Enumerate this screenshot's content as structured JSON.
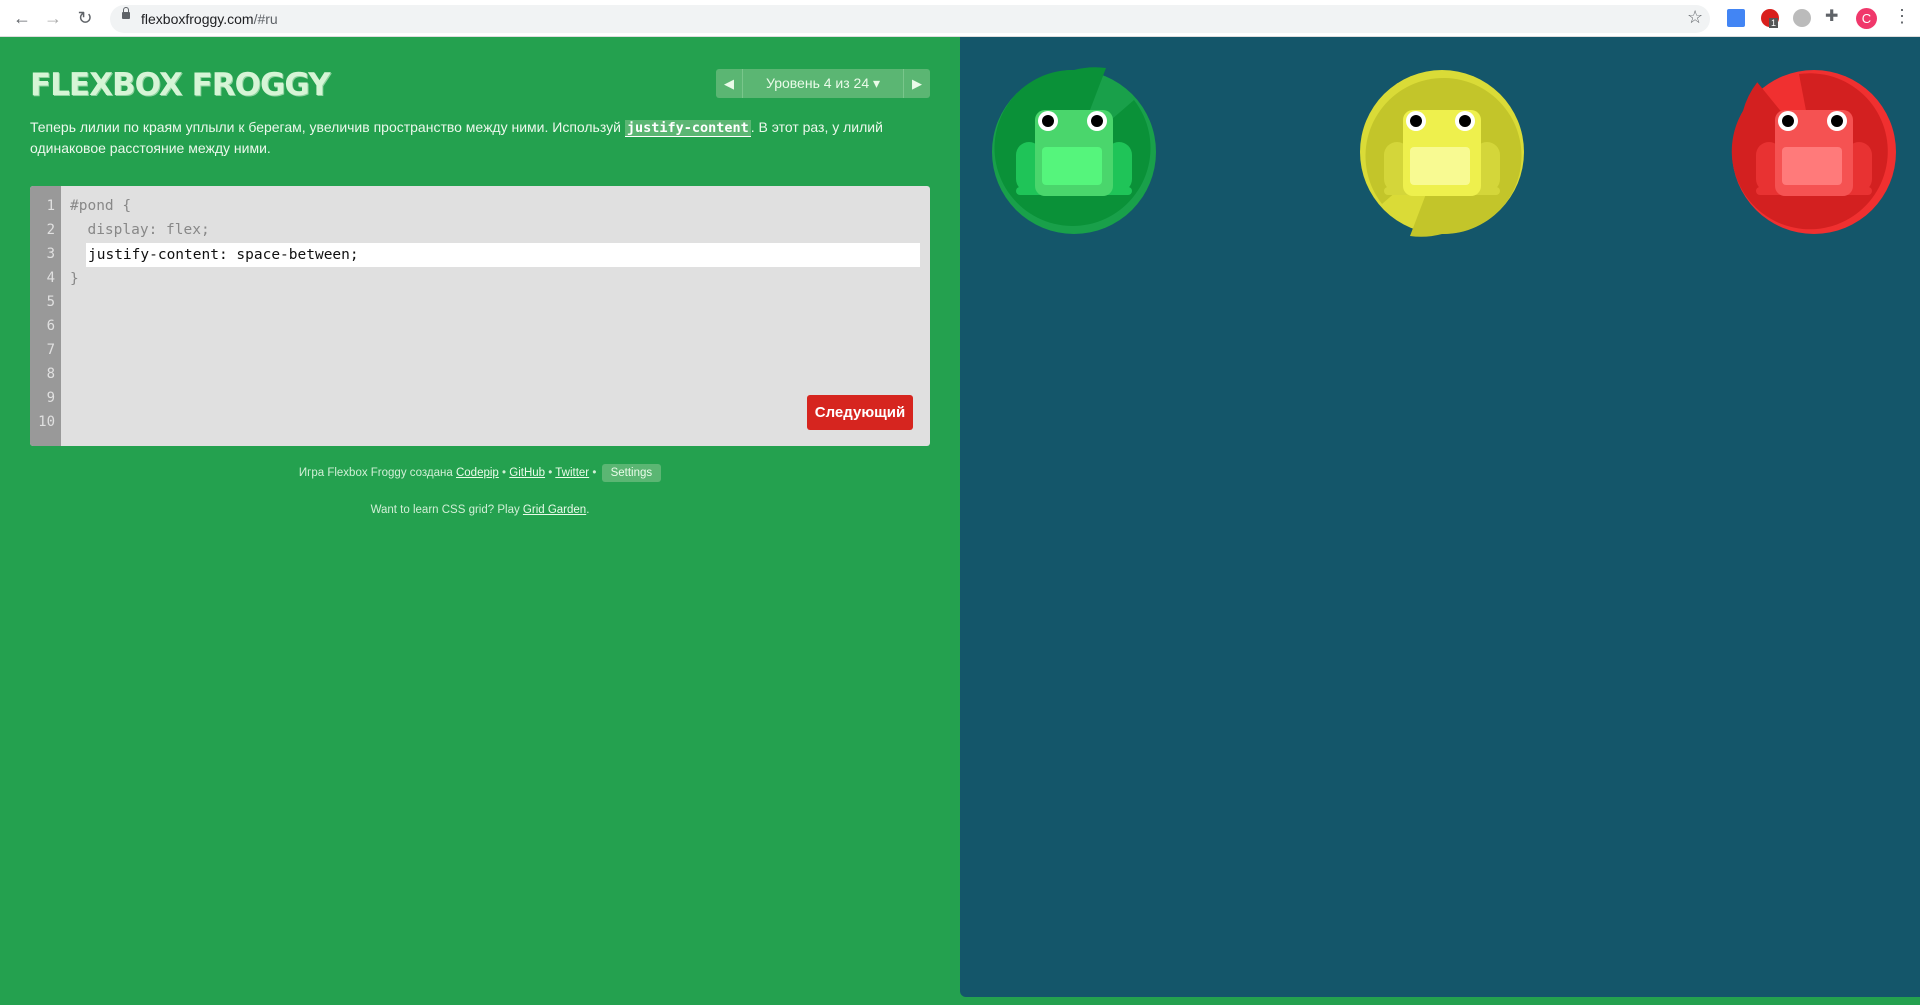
{
  "browser": {
    "url_host": "flexboxfroggy.com",
    "url_path": "/#ru",
    "avatar_letter": "C",
    "badge": "1",
    "icons": [
      "back-icon",
      "forward-icon",
      "reload-icon",
      "lock-icon",
      "star-icon",
      "translate-icon",
      "adblock-icon",
      "globe-icon",
      "puzzle-icon",
      "menu-icon"
    ]
  },
  "header": {
    "logo": "FLEXBOX FROGGY",
    "level_label": "Уровень 4 из 24 ▾"
  },
  "instructions": {
    "before": "Теперь лилии по краям уплыли к берегам, увеличив пространство между ними. Используй ",
    "code": "justify-content",
    "after": ". В этот раз, у лилий одинаковое расстояние между ними."
  },
  "editor": {
    "line_numbers": [
      "1",
      "2",
      "3",
      "4",
      "5",
      "6",
      "7",
      "8",
      "9",
      "10"
    ],
    "line1": "#pond {",
    "line2": "  display: flex;",
    "input_value": "justify-content: space-between;",
    "line4": "}",
    "next_button": "Следующий"
  },
  "footer": {
    "credit_text": "Игра Flexbox Froggy создана ",
    "codepip": "Codepip",
    "sep": " • ",
    "github": "GitHub",
    "twitter": "Twitter",
    "settings": "Settings",
    "grid_text": "Want to learn CSS grid? Play ",
    "grid_link": "Grid Garden",
    "grid_end": "."
  },
  "colors": {
    "left_bg": "#24a14f",
    "pond_bg": "#14566a",
    "next": "#d6251f"
  },
  "pond": {
    "frogs": [
      {
        "color": "green",
        "pad": "#0a9138",
        "pad_edge": "#19a04a",
        "body": "#4ad66c",
        "belly": "#55f57c",
        "legs": "#1fc458"
      },
      {
        "color": "yellow",
        "pad": "#c3c52a",
        "pad_edge": "#dadb37",
        "body": "#eef04d",
        "belly": "#f8fa92",
        "legs": "#d4d63a"
      },
      {
        "color": "red",
        "pad": "#d32020",
        "pad_edge": "#f03030",
        "body": "#f55252",
        "belly": "#ff7a7a",
        "legs": "#e83232"
      }
    ]
  }
}
